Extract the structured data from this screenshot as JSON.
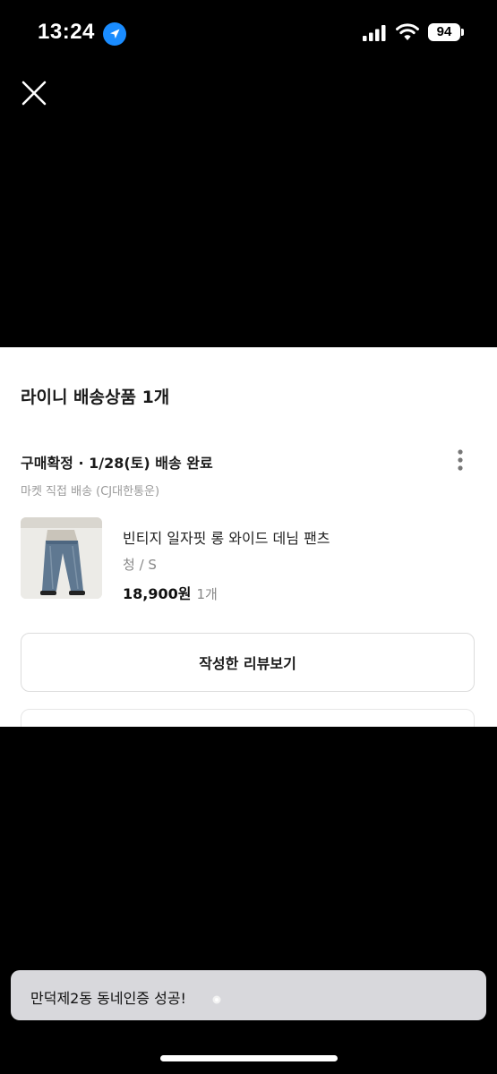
{
  "status_bar": {
    "time": "13:24",
    "battery": "94",
    "location_icon": "location-arrow-icon",
    "signal_icon": "cellular-signal-icon",
    "wifi_icon": "wifi-icon"
  },
  "close_icon": "close-icon",
  "sheet": {
    "title": "라이니 배송상품 1개",
    "order_status": "구매확정 · 1/28(토) 배송 완료",
    "more_icon": "more-vertical-icon",
    "shipping_method": "마켓 직접 배송 (CJ대한통운)",
    "product": {
      "name": "빈티지 일자핏 롱 와이드 데님 팬츠",
      "option": "청 / S",
      "price": "18,900원",
      "quantity": "1개"
    },
    "review_button_label": "작성한 리뷰보기"
  },
  "toast": {
    "message": "만덕제2동 동네인증 성공!"
  },
  "colors": {
    "background": "#000000",
    "sheet": "#ffffff",
    "location_blue": "#1a8cff",
    "toast_bg": "#d8d8dc"
  }
}
